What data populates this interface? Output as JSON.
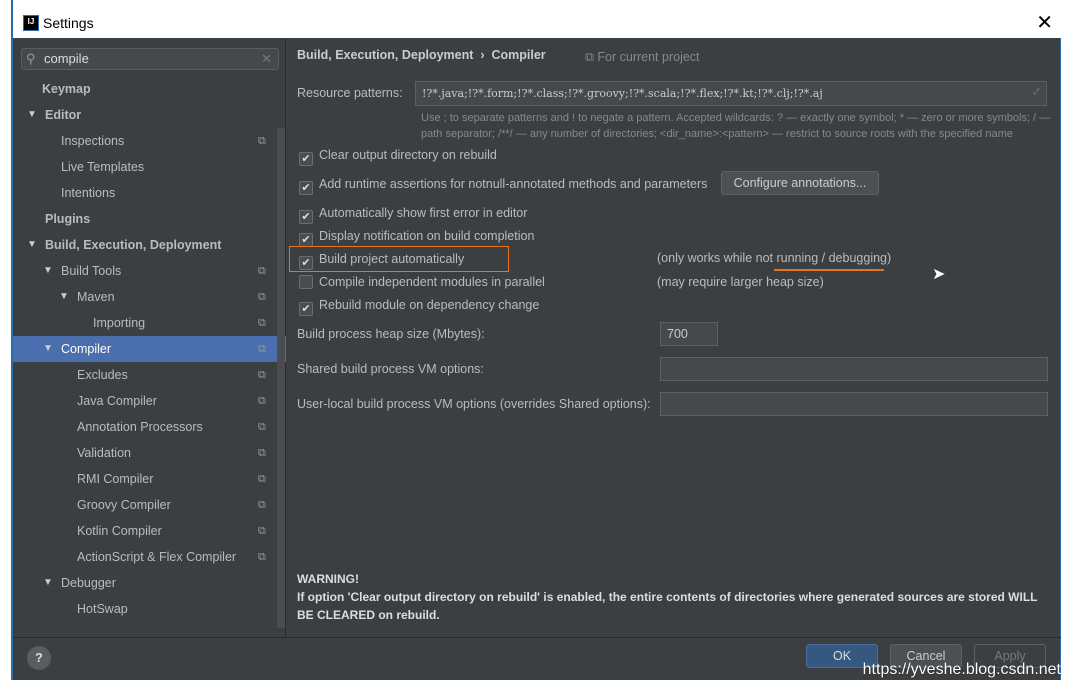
{
  "window": {
    "title": "Settings",
    "logo": "IJ",
    "close_icon": "close-icon"
  },
  "search": {
    "value": "compile"
  },
  "tree": [
    {
      "label": "Keymap",
      "bold": true,
      "indent": 0,
      "arrow": false
    },
    {
      "label": "Editor",
      "bold": true,
      "indent": 0,
      "arrow": true
    },
    {
      "label": "Inspections",
      "indent": 1,
      "copy": true
    },
    {
      "label": "Live Templates",
      "indent": 1
    },
    {
      "label": "Intentions",
      "indent": 1
    },
    {
      "label": "Plugins",
      "bold": true,
      "indent": 0
    },
    {
      "label": "Build, Execution, Deployment",
      "bold": true,
      "indent": 0,
      "arrow": true
    },
    {
      "label": "Build Tools",
      "indent": 1,
      "arrow": true,
      "copy": true
    },
    {
      "label": "Maven",
      "indent": 2,
      "arrow": true,
      "copy": true
    },
    {
      "label": "Importing",
      "indent": 3,
      "copy": true
    },
    {
      "label": "Compiler",
      "indent": 1,
      "arrow": true,
      "copy": true,
      "selected": true
    },
    {
      "label": "Excludes",
      "indent": 2,
      "copy": true
    },
    {
      "label": "Java Compiler",
      "indent": 2,
      "copy": true
    },
    {
      "label": "Annotation Processors",
      "indent": 2,
      "copy": true
    },
    {
      "label": "Validation",
      "indent": 2,
      "copy": true
    },
    {
      "label": "RMI Compiler",
      "indent": 2,
      "copy": true
    },
    {
      "label": "Groovy Compiler",
      "indent": 2,
      "copy": true
    },
    {
      "label": "Kotlin Compiler",
      "indent": 2,
      "copy": true
    },
    {
      "label": "ActionScript & Flex Compiler",
      "indent": 2,
      "copy": true
    },
    {
      "label": "Debugger",
      "indent": 1,
      "arrow": true
    },
    {
      "label": "HotSwap",
      "indent": 2
    }
  ],
  "main": {
    "breadcrumb": "Build, Execution, Deployment  ›  Compiler",
    "for_current_project": "For current project",
    "resource_label": "Resource patterns:",
    "resource_value": "!?*.java;!?*.form;!?*.class;!?*.groovy;!?*.scala;!?*.flex;!?*.kt;!?*.clj;!?*.aj",
    "hint": "Use ; to separate patterns and ! to negate a pattern. Accepted wildcards: ? — exactly one symbol; * — zero or more symbols; / — path separator; /**/ — any number of directories; <dir_name>:<pattern> — restrict to source roots with the specified name",
    "checkboxes": [
      {
        "label": "Clear output directory on rebuild",
        "checked": true
      },
      {
        "label": "Add runtime assertions for notnull-annotated methods and parameters",
        "checked": true
      },
      {
        "label": "Automatically show first error in editor",
        "checked": true
      },
      {
        "label": "Display notification on build completion",
        "checked": true
      },
      {
        "label": "Build project automatically",
        "checked": true
      },
      {
        "label": "Compile independent modules in parallel",
        "checked": false
      },
      {
        "label": "Rebuild module on dependency change",
        "checked": true
      }
    ],
    "configure_annotations": "Configure annotations...",
    "note_build": "(only works while not running / debugging)",
    "note_parallel": "(may require larger heap size)",
    "heap_label": "Build process heap size (Mbytes):",
    "heap_value": "700",
    "shared_label": "Shared build process VM options:",
    "user_label": "User-local build process VM options (overrides Shared options):",
    "warning_title": "WARNING!",
    "warning_text": "If option 'Clear output directory on rebuild' is enabled, the entire contents of directories where generated sources are stored WILL BE CLEARED on rebuild."
  },
  "footer": {
    "help": "?",
    "ok": "OK",
    "cancel": "Cancel",
    "apply": "Apply",
    "watermark": "https://yveshe.blog.csdn.net"
  },
  "colors": {
    "accent": "#4b6eaf",
    "highlight": "#e8731e"
  }
}
